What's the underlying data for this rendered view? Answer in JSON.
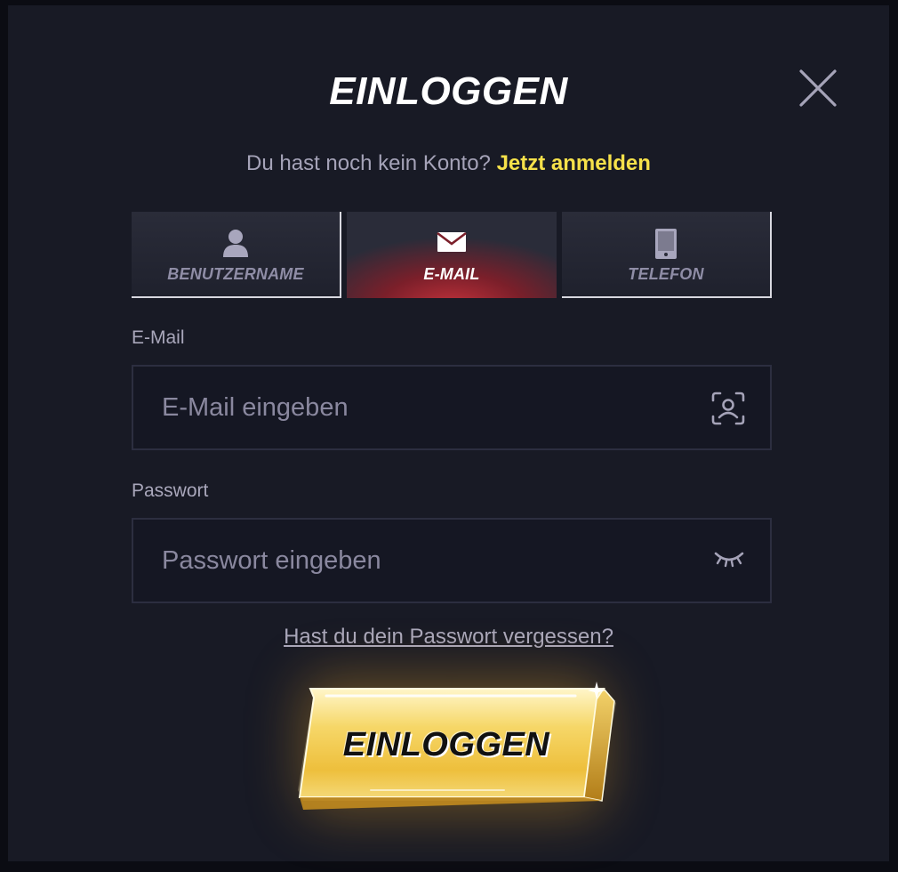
{
  "header": {
    "title": "EINLOGGEN"
  },
  "signup": {
    "question": "Du hast noch kein Konto?",
    "link": "Jetzt anmelden"
  },
  "tabs": [
    {
      "label": "BENUTZERNAME",
      "icon": "user-icon",
      "active": false
    },
    {
      "label": "E-MAIL",
      "icon": "envelope-icon",
      "active": true
    },
    {
      "label": "TELEFON",
      "icon": "phone-icon",
      "active": false
    }
  ],
  "form": {
    "email": {
      "label": "E-Mail",
      "placeholder": "E-Mail eingeben",
      "value": "",
      "icon": "face-scan-icon"
    },
    "password": {
      "label": "Passwort",
      "placeholder": "Passwort eingeben",
      "value": "",
      "icon": "eye-closed-icon"
    }
  },
  "forgot_link": "Hast du dein Passwort vergessen?",
  "submit": {
    "label": "EINLOGGEN"
  },
  "colors": {
    "accent_yellow": "#f6e14a",
    "active_tab_red": "#c0313a",
    "modal_bg": "#181a25",
    "button_gold": "#f3c84a"
  }
}
